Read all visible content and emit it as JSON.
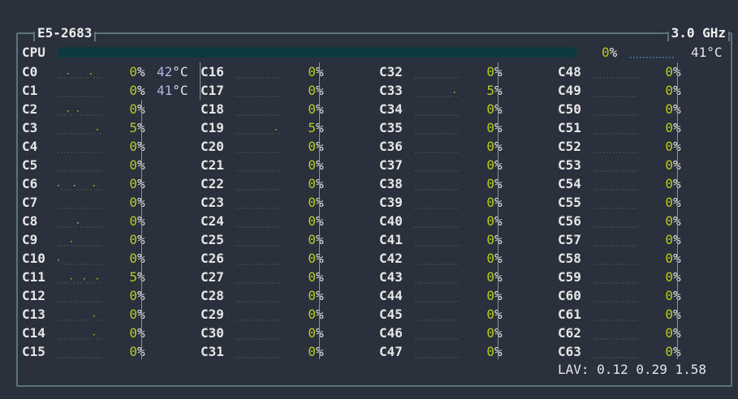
{
  "window": {
    "cpu_model": "E5-2683",
    "frequency": "3.0 GHz"
  },
  "cpu_total": {
    "label": "CPU",
    "usage_percent": 0,
    "usage_text": "0%",
    "temp_text": "41°C"
  },
  "package_temps": [
    {
      "value": "42",
      "unit": "°C"
    },
    {
      "value": "41",
      "unit": "°C"
    }
  ],
  "cores": [
    {
      "label": "C0",
      "pct": "0"
    },
    {
      "label": "C1",
      "pct": "0"
    },
    {
      "label": "C2",
      "pct": "0"
    },
    {
      "label": "C3",
      "pct": "5"
    },
    {
      "label": "C4",
      "pct": "0"
    },
    {
      "label": "C5",
      "pct": "0"
    },
    {
      "label": "C6",
      "pct": "0"
    },
    {
      "label": "C7",
      "pct": "0"
    },
    {
      "label": "C8",
      "pct": "0"
    },
    {
      "label": "C9",
      "pct": "0"
    },
    {
      "label": "C10",
      "pct": "0"
    },
    {
      "label": "C11",
      "pct": "5"
    },
    {
      "label": "C12",
      "pct": "0"
    },
    {
      "label": "C13",
      "pct": "0"
    },
    {
      "label": "C14",
      "pct": "0"
    },
    {
      "label": "C15",
      "pct": "0"
    },
    {
      "label": "C16",
      "pct": "0"
    },
    {
      "label": "C17",
      "pct": "0"
    },
    {
      "label": "C18",
      "pct": "0"
    },
    {
      "label": "C19",
      "pct": "5"
    },
    {
      "label": "C20",
      "pct": "0"
    },
    {
      "label": "C21",
      "pct": "0"
    },
    {
      "label": "C22",
      "pct": "0"
    },
    {
      "label": "C23",
      "pct": "0"
    },
    {
      "label": "C24",
      "pct": "0"
    },
    {
      "label": "C25",
      "pct": "0"
    },
    {
      "label": "C26",
      "pct": "0"
    },
    {
      "label": "C27",
      "pct": "0"
    },
    {
      "label": "C28",
      "pct": "0"
    },
    {
      "label": "C29",
      "pct": "0"
    },
    {
      "label": "C30",
      "pct": "0"
    },
    {
      "label": "C31",
      "pct": "0"
    },
    {
      "label": "C32",
      "pct": "0"
    },
    {
      "label": "C33",
      "pct": "5"
    },
    {
      "label": "C34",
      "pct": "0"
    },
    {
      "label": "C35",
      "pct": "0"
    },
    {
      "label": "C36",
      "pct": "0"
    },
    {
      "label": "C37",
      "pct": "0"
    },
    {
      "label": "C38",
      "pct": "0"
    },
    {
      "label": "C39",
      "pct": "0"
    },
    {
      "label": "C40",
      "pct": "0"
    },
    {
      "label": "C41",
      "pct": "0"
    },
    {
      "label": "C42",
      "pct": "0"
    },
    {
      "label": "C43",
      "pct": "0"
    },
    {
      "label": "C44",
      "pct": "0"
    },
    {
      "label": "C45",
      "pct": "0"
    },
    {
      "label": "C46",
      "pct": "0"
    },
    {
      "label": "C47",
      "pct": "0"
    },
    {
      "label": "C48",
      "pct": "0"
    },
    {
      "label": "C49",
      "pct": "0"
    },
    {
      "label": "C50",
      "pct": "0"
    },
    {
      "label": "C51",
      "pct": "0"
    },
    {
      "label": "C52",
      "pct": "0"
    },
    {
      "label": "C53",
      "pct": "0"
    },
    {
      "label": "C54",
      "pct": "0"
    },
    {
      "label": "C55",
      "pct": "0"
    },
    {
      "label": "C56",
      "pct": "0"
    },
    {
      "label": "C57",
      "pct": "0"
    },
    {
      "label": "C58",
      "pct": "0"
    },
    {
      "label": "C59",
      "pct": "0"
    },
    {
      "label": "C60",
      "pct": "0"
    },
    {
      "label": "C61",
      "pct": "0"
    },
    {
      "label": "C62",
      "pct": "0"
    },
    {
      "label": "C63",
      "pct": "0"
    }
  ],
  "load_average": {
    "label": "LAV:",
    "values": [
      "0.12",
      "0.29",
      "1.58"
    ]
  },
  "colors": {
    "background": "#2b313c",
    "border": "#5f7478",
    "percent_green": "#b8cc1e",
    "temp_lavender": "#b4b4e6",
    "bar_fill": "#0d3a40",
    "spark_dim": "#3a5a3a",
    "spark_active": "#b8cc1e",
    "spark_blue": "#4a8ad4"
  }
}
